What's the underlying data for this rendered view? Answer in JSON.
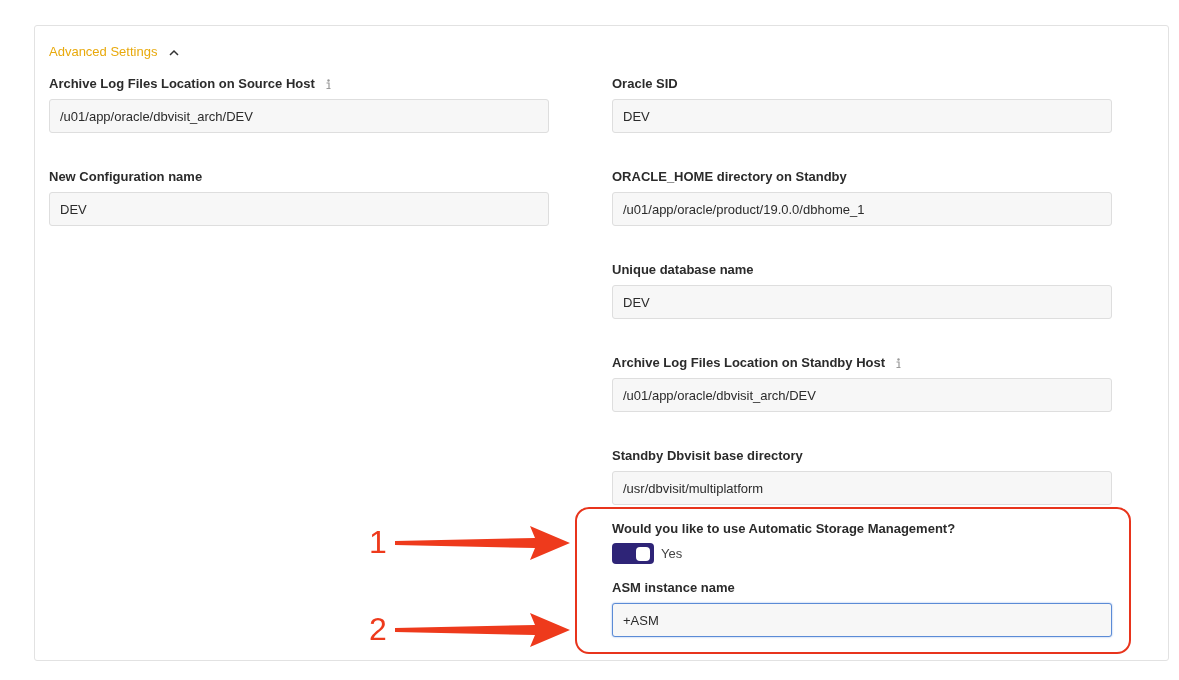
{
  "section": {
    "title": "Advanced Settings",
    "expanded": true
  },
  "left_fields": [
    {
      "label": "Archive Log Files Location on Source Host",
      "info": true,
      "value": "/u01/app/oracle/dbvisit_arch/DEV"
    },
    {
      "label": "New Configuration name",
      "info": false,
      "value": "DEV"
    }
  ],
  "right_fields": [
    {
      "label": "Oracle SID",
      "info": false,
      "value": "DEV"
    },
    {
      "label": "ORACLE_HOME directory on Standby",
      "info": false,
      "value": "/u01/app/oracle/product/19.0.0/dbhome_1"
    },
    {
      "label": "Unique database name",
      "info": false,
      "value": "DEV"
    },
    {
      "label": "Archive Log Files Location on Standby Host",
      "info": true,
      "value": "/u01/app/oracle/dbvisit_arch/DEV"
    },
    {
      "label": "Standby Dbvisit base directory",
      "info": false,
      "value": "/usr/dbvisit/multiplatform"
    }
  ],
  "asm": {
    "question": "Would you like to use Automatic Storage Management?",
    "toggle": {
      "on": true,
      "label": "Yes"
    },
    "instance": {
      "label": "ASM instance name",
      "value": "+ASM",
      "focused": true
    }
  },
  "annotations": [
    {
      "number": "1"
    },
    {
      "number": "2"
    }
  ]
}
